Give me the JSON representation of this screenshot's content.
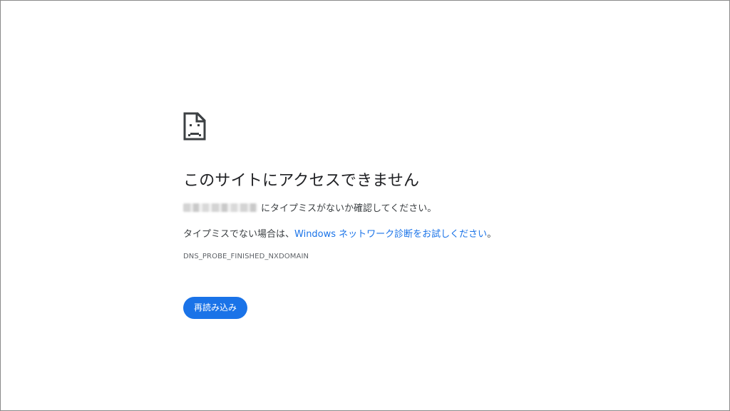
{
  "error": {
    "icon": "sad-page-icon",
    "title": "このサイトにアクセスできません",
    "typo_suffix": "にタイプミスがないか確認してください。",
    "suggestion_prefix": "タイプミスでない場合は、",
    "suggestion_link": "Windows ネットワーク診断をお試しください",
    "suggestion_suffix": "。",
    "code": "DNS_PROBE_FINISHED_NXDOMAIN"
  },
  "actions": {
    "reload_label": "再読み込み"
  },
  "colors": {
    "accent": "#1a73e8",
    "text": "#202124",
    "secondary_text": "#5f6368"
  }
}
